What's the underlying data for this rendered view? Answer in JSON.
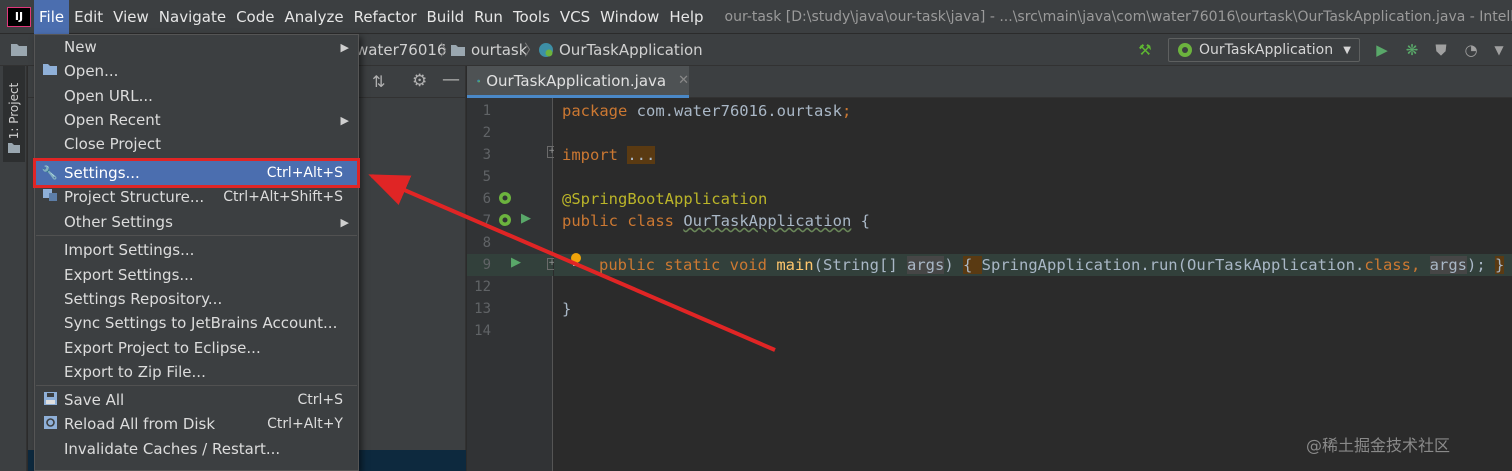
{
  "menubar": {
    "logo": "IJ",
    "items": [
      "File",
      "Edit",
      "View",
      "Navigate",
      "Code",
      "Analyze",
      "Refactor",
      "Build",
      "Run",
      "Tools",
      "VCS",
      "Window",
      "Help"
    ],
    "window_title": "our-task [D:\\study\\java\\our-task\\java] - ...\\src\\main\\java\\com\\water76016\\ourtask\\OurTaskApplication.java - IntelliJ"
  },
  "navbar": {
    "crumbs": [
      "water76016",
      "ourtask",
      "OurTaskApplication"
    ],
    "run_config": "OurTaskApplication"
  },
  "left_strip": {
    "project_tab": "1: Project"
  },
  "editor": {
    "tab_label": "OurTaskApplication.java",
    "line_numbers": [
      "1",
      "2",
      "3",
      "5",
      "6",
      "7",
      "8",
      "9",
      "12",
      "13",
      "14"
    ],
    "lines": {
      "l1_kw": "package ",
      "l1_pkg": "com.water76016.ourtask",
      "l1_end": ";",
      "l3_kw": "import ",
      "l3_fold": "...",
      "l6_ann": "@SpringBootApplication",
      "l7_kw": "public class ",
      "l7_cls": "OurTaskApplication",
      "l7_end": " {",
      "l9_kw": "public static void ",
      "l9_method": "main",
      "l9_p1": "(",
      "l9_type": "String",
      "l9_p2": "[] ",
      "l9_arg": "args",
      "l9_p3": ") ",
      "l9_brace": "{",
      "l9_sa": "SpringApplication",
      "l9_run": ".run(",
      "l9_ota": "OurTaskApplication",
      "l9_dot": ".",
      "l9_class": "class",
      "l9_comma": ", ",
      "l9_arg2": "args",
      "l9_close": "); ",
      "l9_endbrace": "}",
      "l13": "}"
    }
  },
  "file_menu": {
    "items": [
      {
        "label": "New",
        "shortcut": "",
        "submenu": true
      },
      {
        "label": "Open...",
        "shortcut": "",
        "submenu": false
      },
      {
        "label": "Open URL...",
        "shortcut": "",
        "submenu": false
      },
      {
        "label": "Open Recent",
        "shortcut": "",
        "submenu": true
      },
      {
        "label": "Close Project",
        "shortcut": "",
        "submenu": false
      },
      {
        "label": "Settings...",
        "shortcut": "Ctrl+Alt+S",
        "submenu": false
      },
      {
        "label": "Project Structure...",
        "shortcut": "Ctrl+Alt+Shift+S",
        "submenu": false
      },
      {
        "label": "Other Settings",
        "shortcut": "",
        "submenu": true
      },
      {
        "label": "Import Settings...",
        "shortcut": "",
        "submenu": false
      },
      {
        "label": "Export Settings...",
        "shortcut": "",
        "submenu": false
      },
      {
        "label": "Settings Repository...",
        "shortcut": "",
        "submenu": false
      },
      {
        "label": "Sync Settings to JetBrains Account...",
        "shortcut": "",
        "submenu": false
      },
      {
        "label": "Export Project to Eclipse...",
        "shortcut": "",
        "submenu": false
      },
      {
        "label": "Export to Zip File...",
        "shortcut": "",
        "submenu": false
      },
      {
        "label": "Save All",
        "shortcut": "Ctrl+S",
        "submenu": false
      },
      {
        "label": "Reload All from Disk",
        "shortcut": "Ctrl+Alt+Y",
        "submenu": false
      },
      {
        "label": "Invalidate Caches / Restart...",
        "shortcut": "",
        "submenu": false
      }
    ],
    "selected": "Settings..."
  },
  "icons": {
    "open": "folder-icon",
    "settings": "wrench-icon",
    "structure": "project-structure-icon",
    "save": "save-icon",
    "reload": "reload-icon",
    "submenu": "triangle-right-icon"
  },
  "colors": {
    "menu_bg": "#3c3f41",
    "selection": "#4b6eaf",
    "annotation_highlight": "#e02525",
    "editor_bg": "#2b2b2b",
    "keyword": "#cc7832"
  },
  "watermark": "@稀土掘金技术社区"
}
